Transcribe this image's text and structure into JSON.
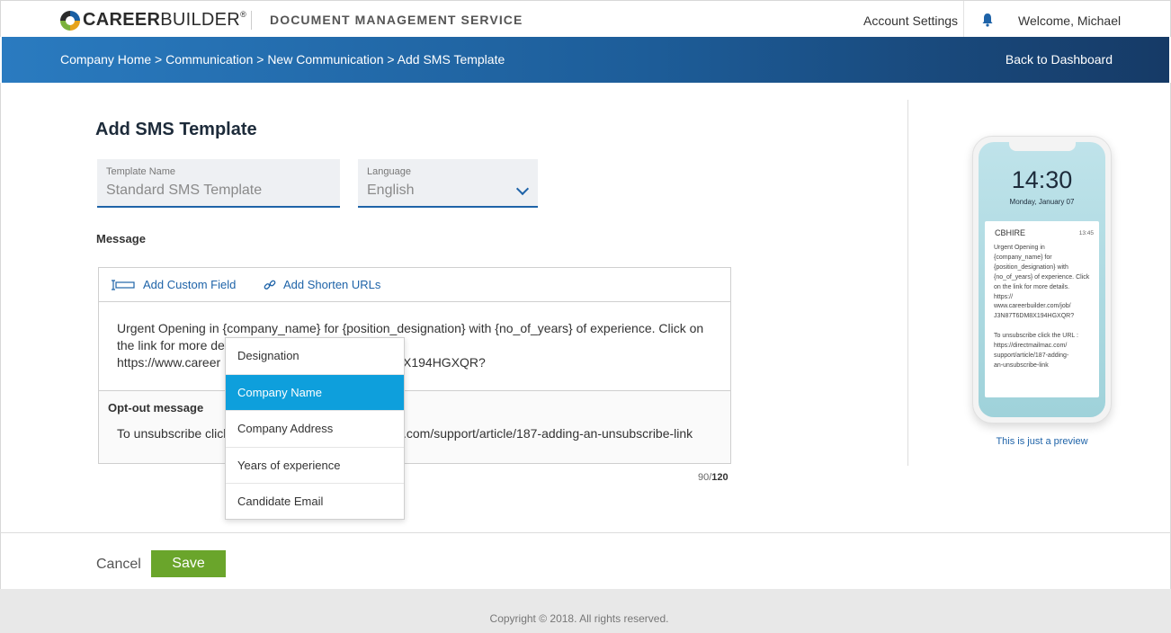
{
  "header": {
    "logo_text_bold": "CAREER",
    "logo_text_light": "BUILDER",
    "logo_reg": "®",
    "service_name": "DOCUMENT MANAGEMENT SERVICE",
    "account_settings": "Account Settings",
    "welcome": "Welcome, Michael"
  },
  "nav": {
    "breadcrumb": "Company Home > Communication > New Communication > Add SMS Template",
    "back_link": "Back to Dashboard"
  },
  "form": {
    "page_title": "Add SMS Template",
    "template_name": {
      "label": "Template Name",
      "value": "Standard SMS Template"
    },
    "language": {
      "label": "Language",
      "value": "English"
    },
    "message_label": "Message",
    "toolbar": {
      "add_custom_field": "Add Custom Field",
      "add_shorten_urls": "Add Shorten URLs"
    },
    "message_line1": "Urgent Opening in {company_name} for {position_designation} with {no_of_years} of experience. Click on",
    "message_line2": "the link for more de",
    "message_line3_start": "https://www.career",
    "message_line3_end": "X194HGXQR?",
    "optout_title": "Opt-out message",
    "optout_start": "To unsubscribe click",
    "optout_end": ".com/support/article/187-adding-an-unsubscribe-link",
    "counter_current": "90/",
    "counter_max": "120"
  },
  "dropdown": {
    "items": [
      "Designation",
      "Company Name",
      "Company Address",
      "Years of experience",
      "Candidate Email"
    ],
    "selected": "Company Name"
  },
  "preview": {
    "time": "14:30",
    "date": "Monday, January 07",
    "sender": "CBHIRE",
    "msg_time": "13:45",
    "body": "Urgent Opening in {company_name} for {position_designation} with {no_of_years} of experience. Click on the link for more details.\nhttps://\nwww.careerbuilder.com/job/\nJ3N87T6DM8X194HGXQR?\n\nTo unsubscribe click the URL :\nhttps://directmailmac.com/\nsupport/article/187-adding-\nan-unsubscribe-link",
    "note": "This is just a preview"
  },
  "actions": {
    "cancel": "Cancel",
    "save": "Save"
  },
  "footer": {
    "copyright": "Copyright © 2018. All rights reserved."
  },
  "colors": {
    "brand_blue": "#1e63a8",
    "save_green": "#6aa52b",
    "dropdown_active": "#0e9fdc"
  },
  "icons": [
    "bell-icon",
    "custom-field-icon",
    "link-icon",
    "chevron-down-icon"
  ]
}
